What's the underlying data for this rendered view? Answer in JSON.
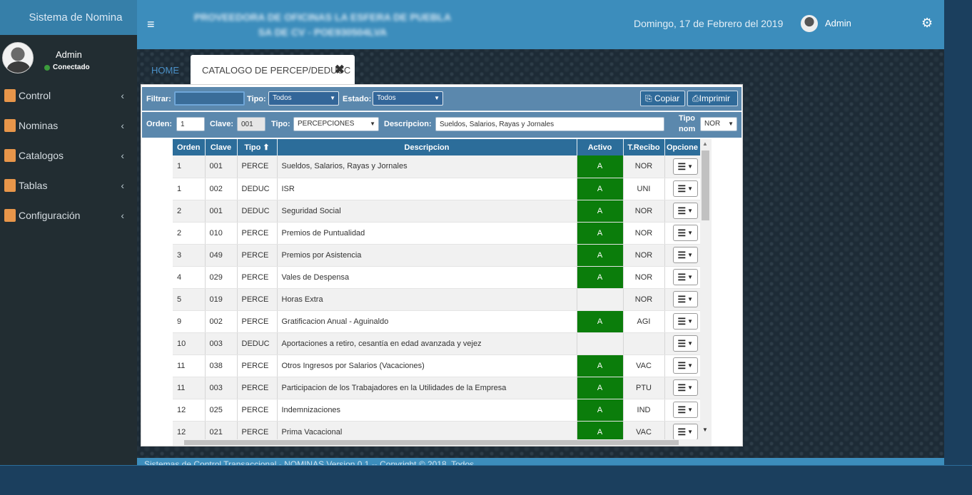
{
  "sidebar": {
    "brand": "Sistema de Nomina",
    "user": {
      "name": "Admin",
      "status": "Conectado"
    },
    "items": [
      {
        "label": "Control",
        "icon": "box-icon",
        "color": "#e8964a"
      },
      {
        "label": "Nominas",
        "icon": "people-icon",
        "color": "#e8964a"
      },
      {
        "label": "Catalogos",
        "icon": "hand-icon",
        "color": "#e8964a"
      },
      {
        "label": "Tablas",
        "icon": "table-icon",
        "color": "#e8964a"
      },
      {
        "label": "Configuración",
        "icon": "tools-icon",
        "color": "#e8964a"
      }
    ]
  },
  "header": {
    "menu_icon": "≡",
    "company": "PROVEEDORA DE OFICINAS LA ESFERA DE PUEBLA SA DE CV - POE930504LVA",
    "date": "Domingo, 17 de Febrero del 2019",
    "user": "Admin",
    "gear_icon": "⚙"
  },
  "tabs": {
    "home": "HOME",
    "active": "CATALOGO DE PERCEP/DEDUCC",
    "close": "✖"
  },
  "filter_bar": {
    "filtrar_label": "Filtrar:",
    "filtrar_value": "",
    "tipo_label": "Tipo:",
    "tipo_value": "Todos",
    "estado_label": "Estado:",
    "estado_value": "Todos",
    "copy_button": "Copiar",
    "print_button": "Imprimir"
  },
  "edit_bar": {
    "orden_label": "Orden:",
    "orden_value": "1",
    "clave_label": "Clave:",
    "clave_value": "001",
    "tipo_label": "Tipo:",
    "tipo_value": "PERCEPCIONES",
    "descripcion_label": "Descripcion:",
    "descripcion_value": "Sueldos, Salarios, Rayas y Jornales",
    "tiponom_label_1": "Tipo",
    "tiponom_label_2": "nom",
    "tiponom_value": "NOR"
  },
  "grid": {
    "columns": [
      "Orden",
      "Clave",
      "Tipo ⬆",
      "Descripcion",
      "Activo",
      "T.Recibo",
      "Opcione"
    ],
    "rows": [
      {
        "orden": "1",
        "clave": "001",
        "tipo": "PERCE",
        "descripcion": "Sueldos, Salarios, Rayas y Jornales",
        "activo": "A",
        "trecibo": "NOR"
      },
      {
        "orden": "1",
        "clave": "002",
        "tipo": "DEDUC",
        "descripcion": "ISR",
        "activo": "A",
        "trecibo": "UNI"
      },
      {
        "orden": "2",
        "clave": "001",
        "tipo": "DEDUC",
        "descripcion": "Seguridad Social",
        "activo": "A",
        "trecibo": "NOR"
      },
      {
        "orden": "2",
        "clave": "010",
        "tipo": "PERCE",
        "descripcion": "Premios de Puntualidad",
        "activo": "A",
        "trecibo": "NOR"
      },
      {
        "orden": "3",
        "clave": "049",
        "tipo": "PERCE",
        "descripcion": "Premios por Asistencia",
        "activo": "A",
        "trecibo": "NOR"
      },
      {
        "orden": "4",
        "clave": "029",
        "tipo": "PERCE",
        "descripcion": "Vales de Despensa",
        "activo": "A",
        "trecibo": "NOR"
      },
      {
        "orden": "5",
        "clave": "019",
        "tipo": "PERCE",
        "descripcion": "Horas Extra",
        "activo": "",
        "trecibo": "NOR"
      },
      {
        "orden": "9",
        "clave": "002",
        "tipo": "PERCE",
        "descripcion": "Gratificacion Anual - Aguinaldo",
        "activo": "A",
        "trecibo": "AGI"
      },
      {
        "orden": "10",
        "clave": "003",
        "tipo": "DEDUC",
        "descripcion": "Aportaciones a retiro, cesantía en edad avanzada y vejez",
        "activo": "",
        "trecibo": ""
      },
      {
        "orden": "11",
        "clave": "038",
        "tipo": "PERCE",
        "descripcion": "Otros Ingresos por Salarios (Vacaciones)",
        "activo": "A",
        "trecibo": "VAC"
      },
      {
        "orden": "11",
        "clave": "003",
        "tipo": "PERCE",
        "descripcion": "Participacion de los Trabajadores en la Utilidades de la Empresa",
        "activo": "A",
        "trecibo": "PTU"
      },
      {
        "orden": "12",
        "clave": "025",
        "tipo": "PERCE",
        "descripcion": "Indemnizaciones",
        "activo": "A",
        "trecibo": "IND"
      },
      {
        "orden": "12",
        "clave": "021",
        "tipo": "PERCE",
        "descripcion": "Prima Vacacional",
        "activo": "A",
        "trecibo": "VAC"
      }
    ],
    "options_icon": "☰",
    "options_caret": "▼"
  },
  "footer": {
    "text": "Sistemas de Control Transaccional - NOMINAS Version 0.1 -- Copyright © 2018. Todos"
  },
  "colors": {
    "header": "#3c8dbc",
    "sidebar": "#222d32",
    "active_green": "#0b7d0b",
    "toolbar": "#5b88ad"
  }
}
